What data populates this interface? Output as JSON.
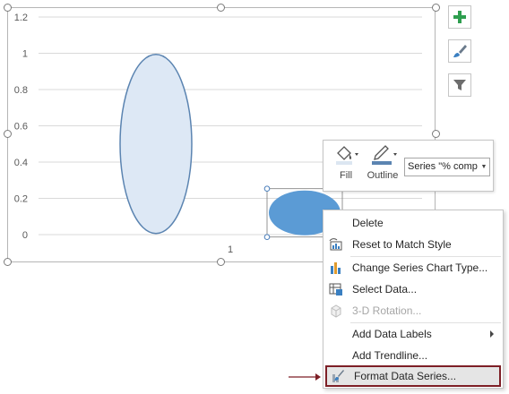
{
  "chart_data": {
    "type": "bubble",
    "y_ticks": [
      "1.2",
      "1",
      "0.8",
      "0.6",
      "0.4",
      "0.2",
      "0"
    ],
    "x_ticks": [
      "1"
    ],
    "ylim": [
      0,
      1.2
    ],
    "grid": true,
    "series": [
      {
        "x": 1,
        "y": 0.5,
        "color": "#dde8f5",
        "stroke": "#5b84b1"
      },
      {
        "x": 2,
        "y": 0.12,
        "color": "#5b9bd5",
        "selected": true
      }
    ]
  },
  "side_buttons": {
    "add_elements": "plus-icon",
    "styles": "brush-icon",
    "filters": "filter-icon"
  },
  "mini_toolbar": {
    "fill_label": "Fill",
    "outline_label": "Outline",
    "series_value": "Series \"% comp"
  },
  "context_menu": {
    "items": [
      {
        "label": "Delete",
        "icon": "none",
        "disabled": false
      },
      {
        "label": "Reset to Match Style",
        "icon": "reset-style-icon",
        "disabled": false
      },
      {
        "label": "Change Series Chart Type...",
        "icon": "chart-type-icon",
        "disabled": false
      },
      {
        "label": "Select Data...",
        "icon": "select-data-icon",
        "disabled": false
      },
      {
        "label": "3-D Rotation...",
        "icon": "cube-icon",
        "disabled": true
      },
      {
        "label": "Add Data Labels",
        "icon": "none",
        "disabled": false,
        "submenu": true
      },
      {
        "label": "Add Trendline...",
        "icon": "none",
        "disabled": false
      },
      {
        "label": "Format Data Series...",
        "icon": "format-series-icon",
        "disabled": false,
        "highlighted": true
      }
    ]
  },
  "colors": {
    "highlight_border": "#7d1f26",
    "accent_green": "#2e9e4f",
    "bubble_selected": "#5b9bd5"
  }
}
